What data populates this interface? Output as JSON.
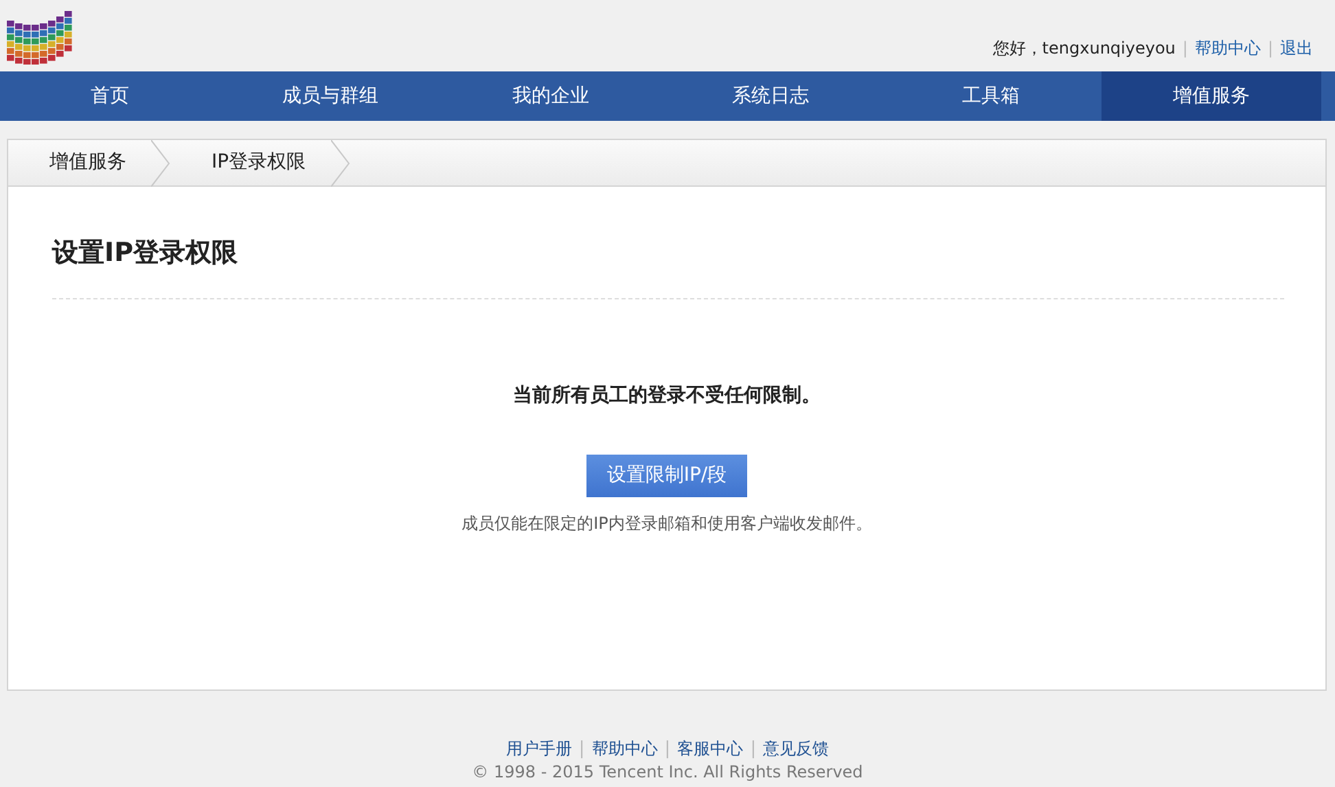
{
  "header": {
    "greeting": "您好，tengxunqiyeyou",
    "links": [
      {
        "separator": "|",
        "label": "帮助中心"
      },
      {
        "separator": "|",
        "label": "退出"
      }
    ]
  },
  "nav": [
    {
      "label": "首页",
      "selected": false
    },
    {
      "label": "成员与群组",
      "selected": false
    },
    {
      "label": "我的企业",
      "selected": false
    },
    {
      "label": "系统日志",
      "selected": false
    },
    {
      "label": "工具箱",
      "selected": false
    },
    {
      "label": "增值服务",
      "selected": true
    }
  ],
  "breadcrumb": [
    "增值服务",
    "IP登录权限"
  ],
  "panel": {
    "title": "设置IP登录权限",
    "message": "当前所有员工的登录不受任何限制。",
    "button": "设置限制IP/段",
    "hint": "成员仅能在限定的IP内登录邮箱和使用客户端收发邮件。"
  },
  "footer": {
    "links": [
      {
        "label": "用户手册"
      },
      {
        "separator": "|",
        "label": "帮助中心"
      },
      {
        "separator": "|",
        "label": "客服中心"
      },
      {
        "separator": "|",
        "label": "意见反馈"
      }
    ],
    "copyright": "© 1998 - 2015 Tencent Inc. All Rights Reserved"
  }
}
